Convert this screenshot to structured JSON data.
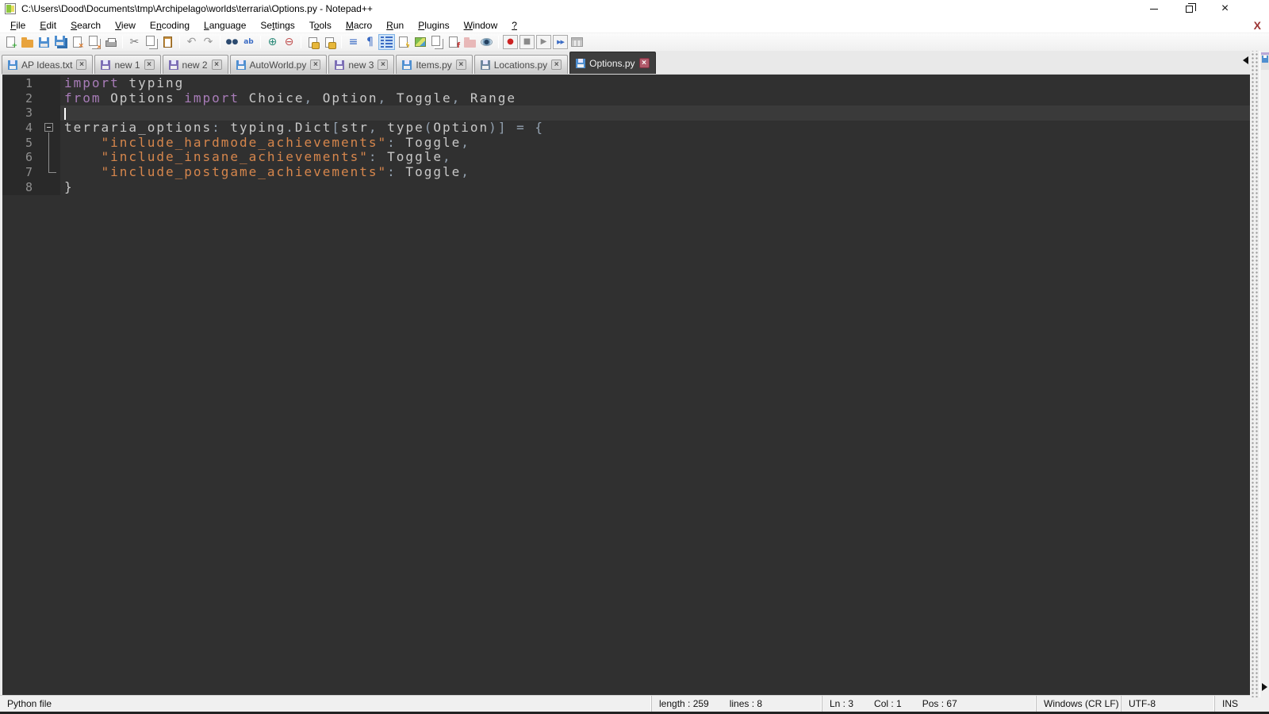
{
  "window": {
    "title": "C:\\Users\\Dood\\Documents\\tmp\\Archipelago\\worlds\\terraria\\Options.py - Notepad++",
    "controls": {
      "minimize": "minimize",
      "restore": "restore",
      "close": "×"
    }
  },
  "menu": {
    "items": [
      {
        "label": "File",
        "u": 0
      },
      {
        "label": "Edit",
        "u": 0
      },
      {
        "label": "Search",
        "u": 0
      },
      {
        "label": "View",
        "u": 0
      },
      {
        "label": "Encoding",
        "u": 1
      },
      {
        "label": "Language",
        "u": 0
      },
      {
        "label": "Settings",
        "u": 2
      },
      {
        "label": "Tools",
        "u": 1
      },
      {
        "label": "Macro",
        "u": 0
      },
      {
        "label": "Run",
        "u": 0
      },
      {
        "label": "Plugins",
        "u": 0
      },
      {
        "label": "Window",
        "u": 0
      },
      {
        "label": "?",
        "u": 0
      }
    ],
    "doc_close_label": "X"
  },
  "toolbar": {
    "icons": [
      {
        "name": "new-file-icon",
        "kind": "page",
        "badge": "+",
        "badge_color": "#2fa52f"
      },
      {
        "name": "open-file-icon",
        "kind": "folder",
        "color": "#e8a33d"
      },
      {
        "name": "save-icon",
        "kind": "floppy",
        "color": "#4f8fd0"
      },
      {
        "name": "save-all-icon",
        "kind": "floppy2",
        "color": "#4f8fd0"
      },
      {
        "name": "close-doc-icon",
        "kind": "page",
        "badge": "×",
        "badge_color": "#e07b2a"
      },
      {
        "name": "close-all-docs-icon",
        "kind": "page2",
        "badge": "×",
        "badge_color": "#e07b2a"
      },
      {
        "name": "print-icon",
        "kind": "printer"
      },
      {
        "kind": "sep"
      },
      {
        "name": "cut-icon",
        "kind": "char",
        "glyph": "✂",
        "color": "#777777"
      },
      {
        "name": "copy-icon",
        "kind": "page2"
      },
      {
        "name": "paste-icon",
        "kind": "clipboard"
      },
      {
        "kind": "sep"
      },
      {
        "name": "undo-icon",
        "kind": "char",
        "glyph": "↶",
        "color": "#9a9a9a"
      },
      {
        "name": "redo-icon",
        "kind": "char",
        "glyph": "↷",
        "color": "#9a9a9a"
      },
      {
        "kind": "sep"
      },
      {
        "name": "find-icon",
        "kind": "char",
        "glyph": "●●",
        "color": "#2b4a6f",
        "small": true
      },
      {
        "name": "replace-icon",
        "kind": "char",
        "glyph": "ab",
        "color": "#3a6bc4",
        "small": true
      },
      {
        "kind": "sep"
      },
      {
        "name": "zoom-in-icon",
        "kind": "char",
        "glyph": "⊕",
        "color": "#2e8b7a"
      },
      {
        "name": "zoom-out-icon",
        "kind": "char",
        "glyph": "⊖",
        "color": "#c05050"
      },
      {
        "kind": "sep"
      },
      {
        "name": "sync-vertical-scroll-icon",
        "kind": "lockpage"
      },
      {
        "name": "sync-horizontal-scroll-icon",
        "kind": "lockpage"
      },
      {
        "kind": "sep"
      },
      {
        "name": "word-wrap-icon",
        "kind": "char",
        "glyph": "≡",
        "color": "#3a6bc4"
      },
      {
        "name": "show-all-characters-icon",
        "kind": "char",
        "glyph": "¶",
        "color": "#3a6bc4"
      },
      {
        "name": "show-indent-guide-icon",
        "kind": "indent",
        "pressed": true
      },
      {
        "name": "plugin-lightning-icon",
        "kind": "page",
        "badge": "ϟ",
        "badge_color": "#e0b020"
      },
      {
        "name": "document-map-icon",
        "kind": "map"
      },
      {
        "name": "doc-switcher-icon",
        "kind": "page2"
      },
      {
        "name": "function-list-icon",
        "kind": "page",
        "badge": "f",
        "badge_color": "#c03030"
      },
      {
        "name": "folder-as-workspace-icon",
        "kind": "folder",
        "color": "#e8b8b8"
      },
      {
        "name": "monitoring-eye-icon",
        "kind": "eye"
      },
      {
        "kind": "sep"
      },
      {
        "name": "macro-record-icon",
        "kind": "boxchar",
        "glyph": "●",
        "color": "#cc2222"
      },
      {
        "name": "macro-stop-icon",
        "kind": "boxchar",
        "glyph": "■",
        "color": "#8a8a8a"
      },
      {
        "name": "macro-play-icon",
        "kind": "boxchar",
        "glyph": "▶",
        "color": "#8a8a8a"
      },
      {
        "name": "macro-run-multiple-icon",
        "kind": "boxchar",
        "glyph": "▶▶",
        "color": "#3a6bc4",
        "small": true
      },
      {
        "name": "macro-save-icon",
        "kind": "grid"
      }
    ]
  },
  "tabs": [
    {
      "label": "AP Ideas.txt",
      "floppy_color": "#4f8fd0",
      "active": false
    },
    {
      "label": "new 1",
      "floppy_color": "#7d6fb5",
      "active": false
    },
    {
      "label": "new 2",
      "floppy_color": "#7d6fb5",
      "active": false
    },
    {
      "label": "AutoWorld.py",
      "floppy_color": "#4f8fd0",
      "active": false
    },
    {
      "label": "new 3",
      "floppy_color": "#7d6fb5",
      "active": false
    },
    {
      "label": "Items.py",
      "floppy_color": "#4f8fd0",
      "active": false
    },
    {
      "label": "Locations.py",
      "floppy_color": "#6f87a0",
      "active": false
    },
    {
      "label": "Options.py",
      "floppy_color": "#4f8fd0",
      "active": true
    }
  ],
  "editor": {
    "colors": {
      "background": "#303030",
      "gutter": "#292929",
      "current_line": "#3a3a3a",
      "default": "#c8c8c8",
      "keyword": "#a87cb8",
      "string": "#d6864c",
      "operator": "#93a1b0"
    },
    "current_line": 3,
    "caret": {
      "line": 3,
      "col": 1
    },
    "lines": [
      {
        "num": "1",
        "fold": "",
        "tokens": [
          [
            "k",
            "import"
          ],
          [
            "d",
            " typing"
          ]
        ]
      },
      {
        "num": "2",
        "fold": "",
        "tokens": [
          [
            "k",
            "from"
          ],
          [
            "d",
            " Options "
          ],
          [
            "k",
            "import"
          ],
          [
            "d",
            " Choice"
          ],
          [
            "o",
            ","
          ],
          [
            "d",
            " Option"
          ],
          [
            "o",
            ","
          ],
          [
            "d",
            " Toggle"
          ],
          [
            "o",
            ","
          ],
          [
            "d",
            " Range"
          ]
        ]
      },
      {
        "num": "3",
        "fold": "",
        "tokens": []
      },
      {
        "num": "4",
        "fold": "box",
        "tokens": [
          [
            "d",
            "terraria_options"
          ],
          [
            "o",
            ":"
          ],
          [
            "d",
            " typing"
          ],
          [
            "o",
            "."
          ],
          [
            "d",
            "Dict"
          ],
          [
            "o",
            "["
          ],
          [
            "d",
            "str"
          ],
          [
            "o",
            ","
          ],
          [
            "d",
            " type"
          ],
          [
            "o",
            "("
          ],
          [
            "d",
            "Option"
          ],
          [
            "o",
            ")"
          ],
          [
            "o",
            "]"
          ],
          [
            "d",
            " "
          ],
          [
            "o",
            "="
          ],
          [
            "d",
            " "
          ],
          [
            "o",
            "{"
          ]
        ]
      },
      {
        "num": "5",
        "fold": "line",
        "tokens": [
          [
            "d",
            "    "
          ],
          [
            "s",
            "\"include_hardmode_achievements\""
          ],
          [
            "o",
            ":"
          ],
          [
            "d",
            " Toggle"
          ],
          [
            "o",
            ","
          ]
        ]
      },
      {
        "num": "6",
        "fold": "line",
        "tokens": [
          [
            "d",
            "    "
          ],
          [
            "s",
            "\"include_insane_achievements\""
          ],
          [
            "o",
            ":"
          ],
          [
            "d",
            " Toggle"
          ],
          [
            "o",
            ","
          ]
        ]
      },
      {
        "num": "7",
        "fold": "corner",
        "tokens": [
          [
            "d",
            "    "
          ],
          [
            "s",
            "\"include_postgame_achievements\""
          ],
          [
            "o",
            ":"
          ],
          [
            "d",
            " Toggle"
          ],
          [
            "o",
            ","
          ]
        ]
      },
      {
        "num": "8",
        "fold": "",
        "tokens": [
          [
            "d",
            "}"
          ]
        ]
      }
    ]
  },
  "status_bar": {
    "doc_type": "Python file",
    "length": "length : 259",
    "lines": "lines : 8",
    "ln": "Ln : 3",
    "col": "Col : 1",
    "pos": "Pos : 67",
    "eol": "Windows (CR LF)",
    "encoding": "UTF-8",
    "mode": "INS"
  }
}
